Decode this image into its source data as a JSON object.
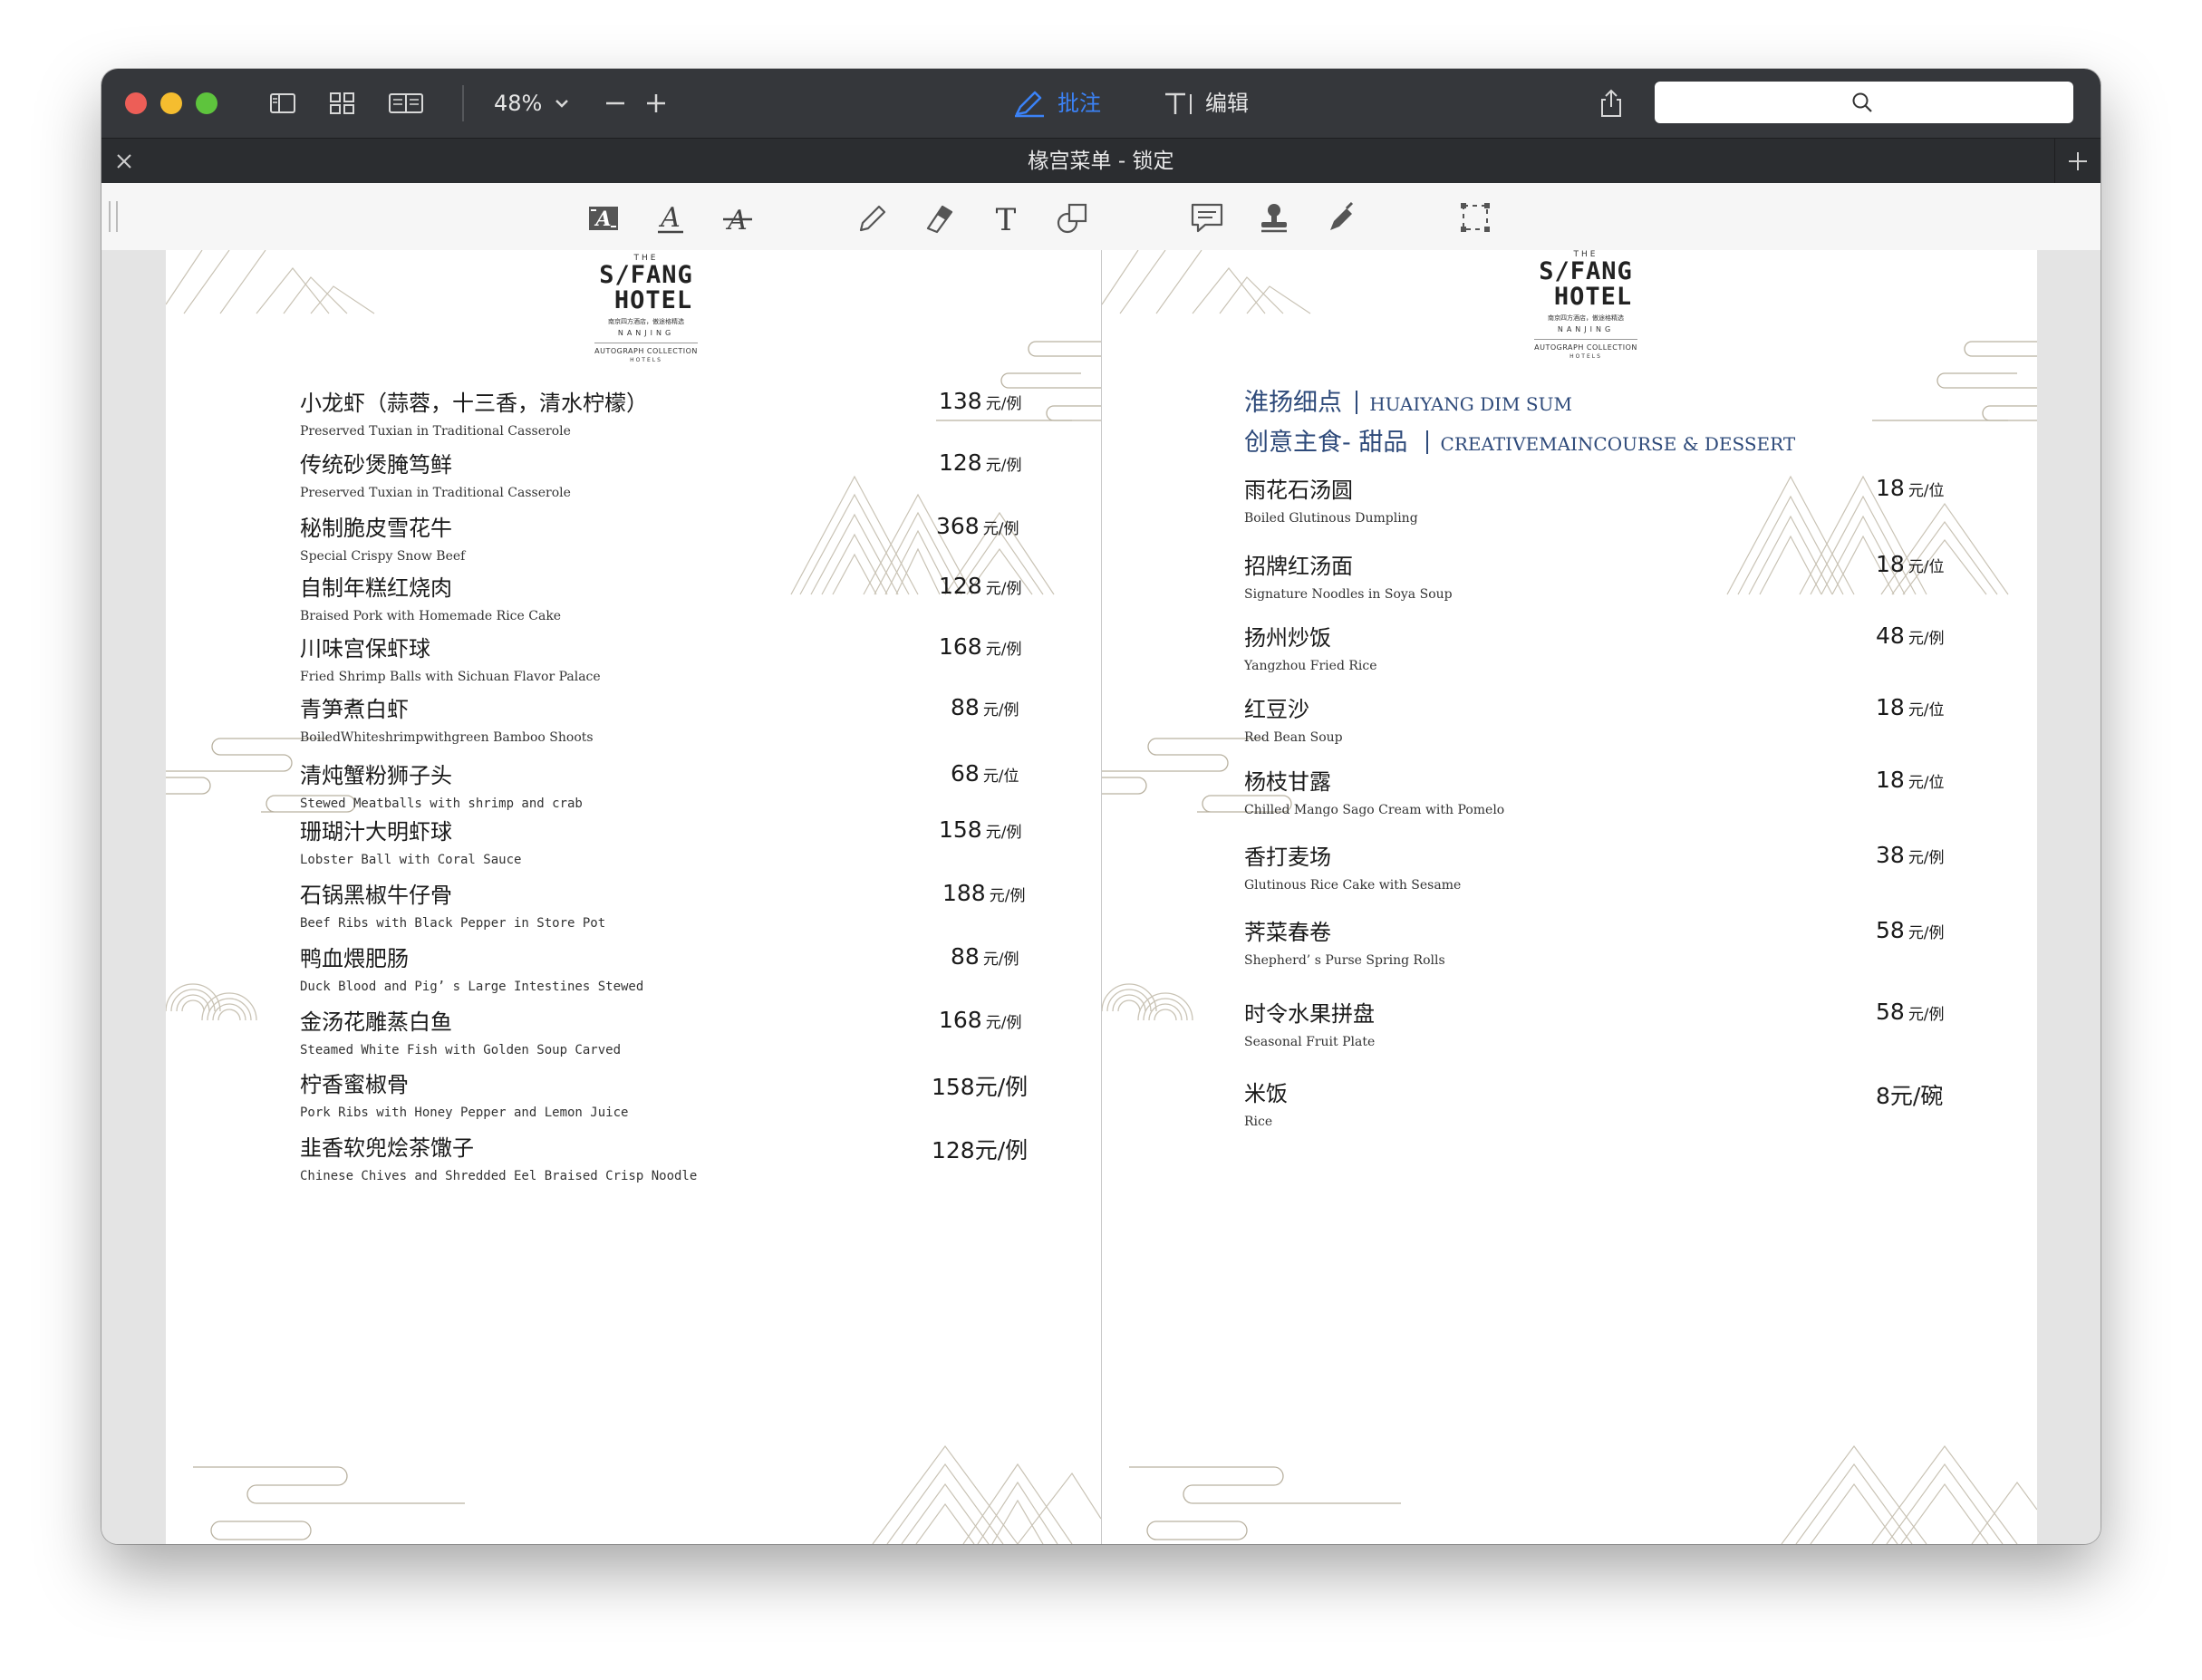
{
  "toolbar": {
    "zoom": "48%",
    "annotate_label": "批注",
    "edit_label": "编辑",
    "accent_color": "#3b82f6"
  },
  "tab": {
    "title": "椽宫菜单 - 锁定"
  },
  "annotation_tools": [
    "text-style-icon",
    "underline-icon",
    "strikethrough-icon",
    "pencil-icon",
    "eraser-icon",
    "text-tool-icon",
    "shape-icon",
    "comment-icon",
    "stamp-icon",
    "signature-pen-icon",
    "selection-icon"
  ],
  "logo": {
    "the": "THE",
    "name_line1": "S/FANG",
    "name_line2": "HOTEL",
    "sub": "南京四方酒店，傲途格精选",
    "city": "NANJING",
    "collection": "AUTOGRAPH COLLECTION",
    "hotels": "HOTELS"
  },
  "left_page": {
    "items": [
      {
        "zh": "小龙虾（蒜蓉，十三香，清水柠檬）",
        "en": "Preserved Tuxian in Traditional Casserole",
        "price": "138",
        "unit": "元/例"
      },
      {
        "zh": "传统砂煲腌笃鲜",
        "en": "Preserved Tuxian in Traditional Casserole",
        "price": "128",
        "unit": "元/例"
      },
      {
        "zh": "秘制脆皮雪花牛",
        "en": "Special Crispy Snow Beef",
        "price": "368",
        "unit": "元/例"
      },
      {
        "zh": "自制年糕红烧肉",
        "en": "Braised Pork with Homemade Rice Cake",
        "price": "128",
        "unit": "元/例"
      },
      {
        "zh": "川味宫保虾球",
        "en": "Fried Shrimp Balls with Sichuan Flavor Palace",
        "price": "168",
        "unit": "元/例"
      },
      {
        "zh": "青笋煮白虾",
        "en": "BoiledWhiteshrimpwithgreen Bamboo Shoots",
        "price": "88",
        "unit": "元/例"
      },
      {
        "zh": "清炖蟹粉狮子头",
        "en": "Stewed Meatballs with shrimp and crab",
        "price": "68",
        "unit": "元/位"
      },
      {
        "zh": "珊瑚汁大明虾球",
        "en": "Lobster Ball with Coral Sauce",
        "price": "158",
        "unit": "元/例"
      },
      {
        "zh": "石锅黑椒牛仔骨",
        "en": "Beef Ribs with Black Pepper in Store Pot",
        "price": "188",
        "unit": "元/例"
      },
      {
        "zh": "鸭血煨肥肠",
        "en": "Duck Blood and Pig’ s Large Intestines Stewed",
        "price": "88",
        "unit": "元/例"
      },
      {
        "zh": "金汤花雕蒸白鱼",
        "en": "Steamed White Fish with Golden Soup Carved",
        "price": "168",
        "unit": "元/例"
      },
      {
        "zh": "柠香蜜椒骨",
        "en": "Pork Ribs with Honey Pepper and Lemon Juice",
        "price": "158元/例",
        "unit": ""
      },
      {
        "zh": "韭香软兜烩茶馓子",
        "en": "Chinese Chives and Shredded Eel Braised Crisp  Noodle",
        "price": "128元/例",
        "unit": ""
      }
    ]
  },
  "right_page": {
    "section1_zh": "淮扬细点",
    "section1_en": "HUAIYANG DIM SUM",
    "section2_zh": "创意主食- 甜品",
    "section2_en": "CREATIVEMAINCOURSE & DESSERT",
    "items": [
      {
        "zh": "雨花石汤圆",
        "en": "Boiled Glutinous Dumpling",
        "price": "18",
        "unit": "元/位"
      },
      {
        "zh": "招牌红汤面",
        "en": "Signature Noodles in Soya Soup",
        "price": "18",
        "unit": "元/位"
      },
      {
        "zh": "扬州炒饭",
        "en": "Yangzhou Fried Rice",
        "price": "48",
        "unit": "元/例"
      },
      {
        "zh": "红豆沙",
        "en": "Red  Bean Soup",
        "price": "18",
        "unit": "元/位"
      },
      {
        "zh": "杨枝甘露",
        "en": "Chilled Mango Sago Cream with Pomelo",
        "price": "18",
        "unit": "元/位"
      },
      {
        "zh": "香打麦场",
        "en": "Glutinous Rice Cake with Sesame",
        "price": "38",
        "unit": "元/例"
      },
      {
        "zh": "荠菜春卷",
        "en": "Shepherd’ s  Purse  Spring  Rolls",
        "price": "58",
        "unit": "元/例"
      },
      {
        "zh": "时令水果拼盘",
        "en": "Seasonal Fruit Plate",
        "price": "58",
        "unit": "元/例"
      },
      {
        "zh": "米饭",
        "en": "Rice",
        "price": "8元/碗",
        "unit": ""
      }
    ]
  }
}
